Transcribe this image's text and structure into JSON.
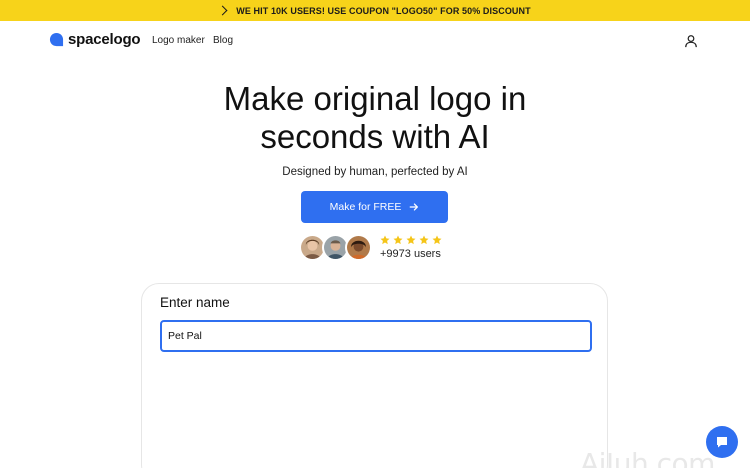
{
  "banner": {
    "text": "WE HIT 10K USERS! USE COUPON \"LOGO50\" FOR 50% DISCOUNT",
    "icon": "chevron-right-icon"
  },
  "nav": {
    "brand": "spacelogo",
    "links": [
      "Logo maker",
      "Blog"
    ],
    "account_icon": "user-icon"
  },
  "hero": {
    "title_line1": "Make original logo in",
    "title_line2": "seconds with AI",
    "subtitle": "Designed by human, perfected by AI",
    "cta_label": "Make for FREE",
    "cta_icon": "arrow-right-icon",
    "rating_stars": 5,
    "users_text": "+9973 users"
  },
  "form": {
    "title": "Enter name",
    "name_value": "Pet Pal"
  },
  "watermark": "AiJuh.com",
  "colors": {
    "banner": "#f7d31a",
    "primary": "#2f6ff0",
    "star": "#f5c518"
  }
}
